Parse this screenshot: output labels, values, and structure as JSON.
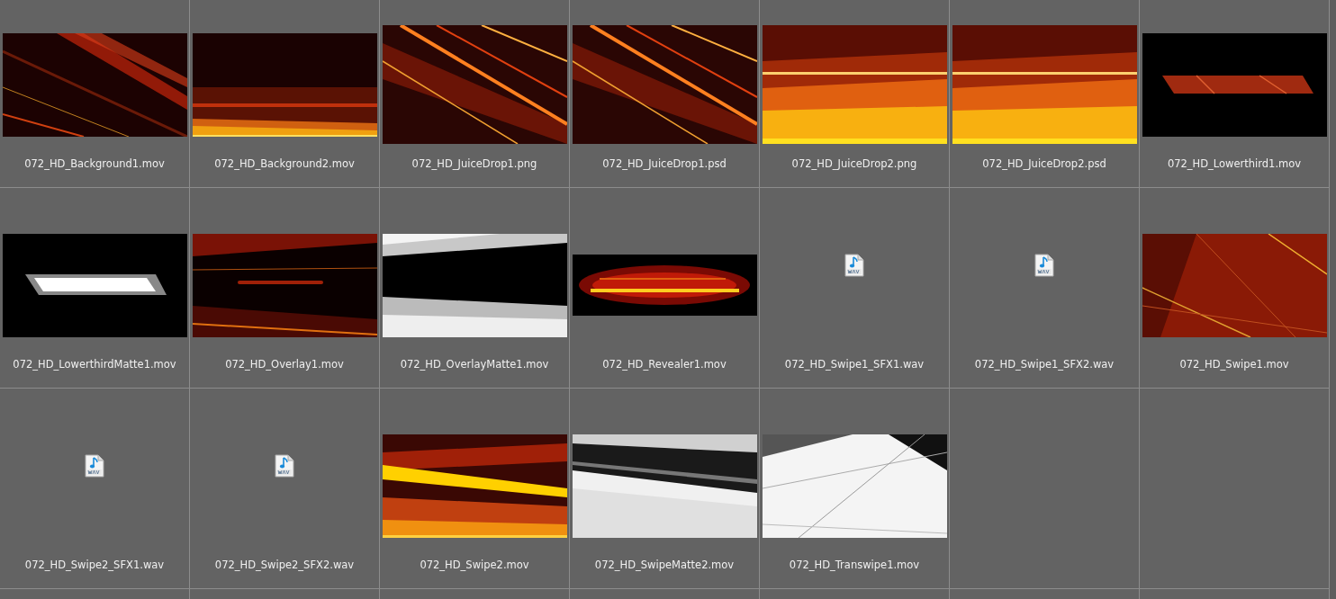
{
  "files": [
    {
      "name": "072_HD_Background1.mov",
      "kind": "picture"
    },
    {
      "name": "072_HD_Background2.mov",
      "kind": "picture"
    },
    {
      "name": "072_HD_JuiceDrop1.png",
      "kind": "picture"
    },
    {
      "name": "072_HD_JuiceDrop1.psd",
      "kind": "picture"
    },
    {
      "name": "072_HD_JuiceDrop2.png",
      "kind": "picture"
    },
    {
      "name": "072_HD_JuiceDrop2.psd",
      "kind": "picture"
    },
    {
      "name": "072_HD_Lowerthird1.mov",
      "kind": "picture"
    },
    {
      "name": "072_HD_LowerthirdMatte1.mov",
      "kind": "picture"
    },
    {
      "name": "072_HD_Overlay1.mov",
      "kind": "picture"
    },
    {
      "name": "072_HD_OverlayMatte1.mov",
      "kind": "picture"
    },
    {
      "name": "072_HD_Revealer1.mov",
      "kind": "picture"
    },
    {
      "name": "072_HD_Swipe1_SFX1.wav",
      "kind": "audio"
    },
    {
      "name": "072_HD_Swipe1_SFX2.wav",
      "kind": "audio"
    },
    {
      "name": "072_HD_Swipe1.mov",
      "kind": "picture"
    },
    {
      "name": "072_HD_Swipe2_SFX1.wav",
      "kind": "audio"
    },
    {
      "name": "072_HD_Swipe2_SFX2.wav",
      "kind": "audio"
    },
    {
      "name": "072_HD_Swipe2.mov",
      "kind": "picture"
    },
    {
      "name": "072_HD_SwipeMatte2.mov",
      "kind": "picture"
    },
    {
      "name": "072_HD_Transwipe1.mov",
      "kind": "picture"
    }
  ]
}
